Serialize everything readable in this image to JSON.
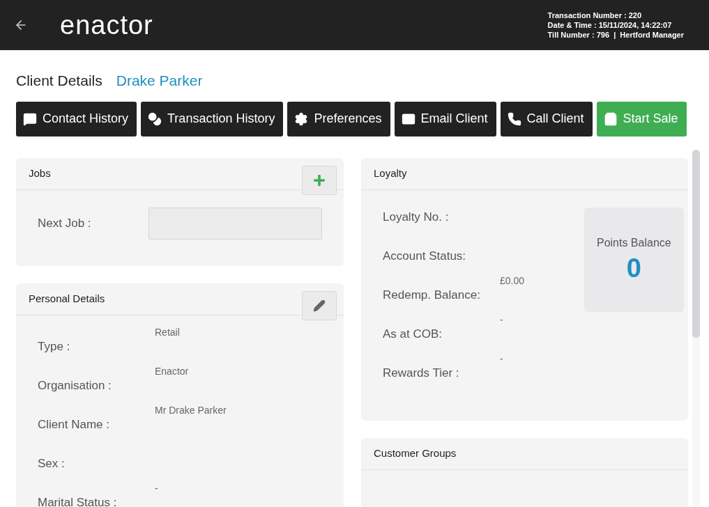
{
  "header": {
    "logo": "enactor",
    "info": [
      "Transaction Number : 220",
      "Date & Time : 15/11/2024, 14:22:07",
      "Till Number : 796  |  Hertford Manager"
    ]
  },
  "page": {
    "title": "Client Details",
    "client": "Drake Parker"
  },
  "actions": [
    {
      "label": "Contact History",
      "kind": "default"
    },
    {
      "label": "Transaction History",
      "kind": "default"
    },
    {
      "label": "Preferences",
      "kind": "default"
    },
    {
      "label": "Email Client",
      "kind": "default"
    },
    {
      "label": "Call Client",
      "kind": "default"
    },
    {
      "label": "Start Sale",
      "kind": "primary"
    }
  ],
  "jobs": {
    "title": "Jobs",
    "next_job_label": "Next Job :"
  },
  "personal": {
    "title": "Personal Details",
    "fields": [
      {
        "label": "Type :",
        "value": "Retail"
      },
      {
        "label": "Organisation :",
        "value": "Enactor"
      },
      {
        "label": "Client Name :",
        "value": "Mr Drake Parker"
      },
      {
        "label": "Sex :"
      },
      {
        "label": "Marital Status :",
        "value": "-"
      }
    ]
  },
  "loyalty": {
    "title": "Loyalty",
    "fields": [
      {
        "label": "Loyalty No. :"
      },
      {
        "label": "Account Status:"
      },
      {
        "label": "Redemp. Balance:",
        "value": "£0.00"
      },
      {
        "label": "As at COB:",
        "value": "-"
      },
      {
        "label": "Rewards Tier :",
        "value": "-"
      }
    ],
    "points_label": "Points Balance",
    "points": "0"
  },
  "groups": {
    "title": "Customer Groups"
  }
}
